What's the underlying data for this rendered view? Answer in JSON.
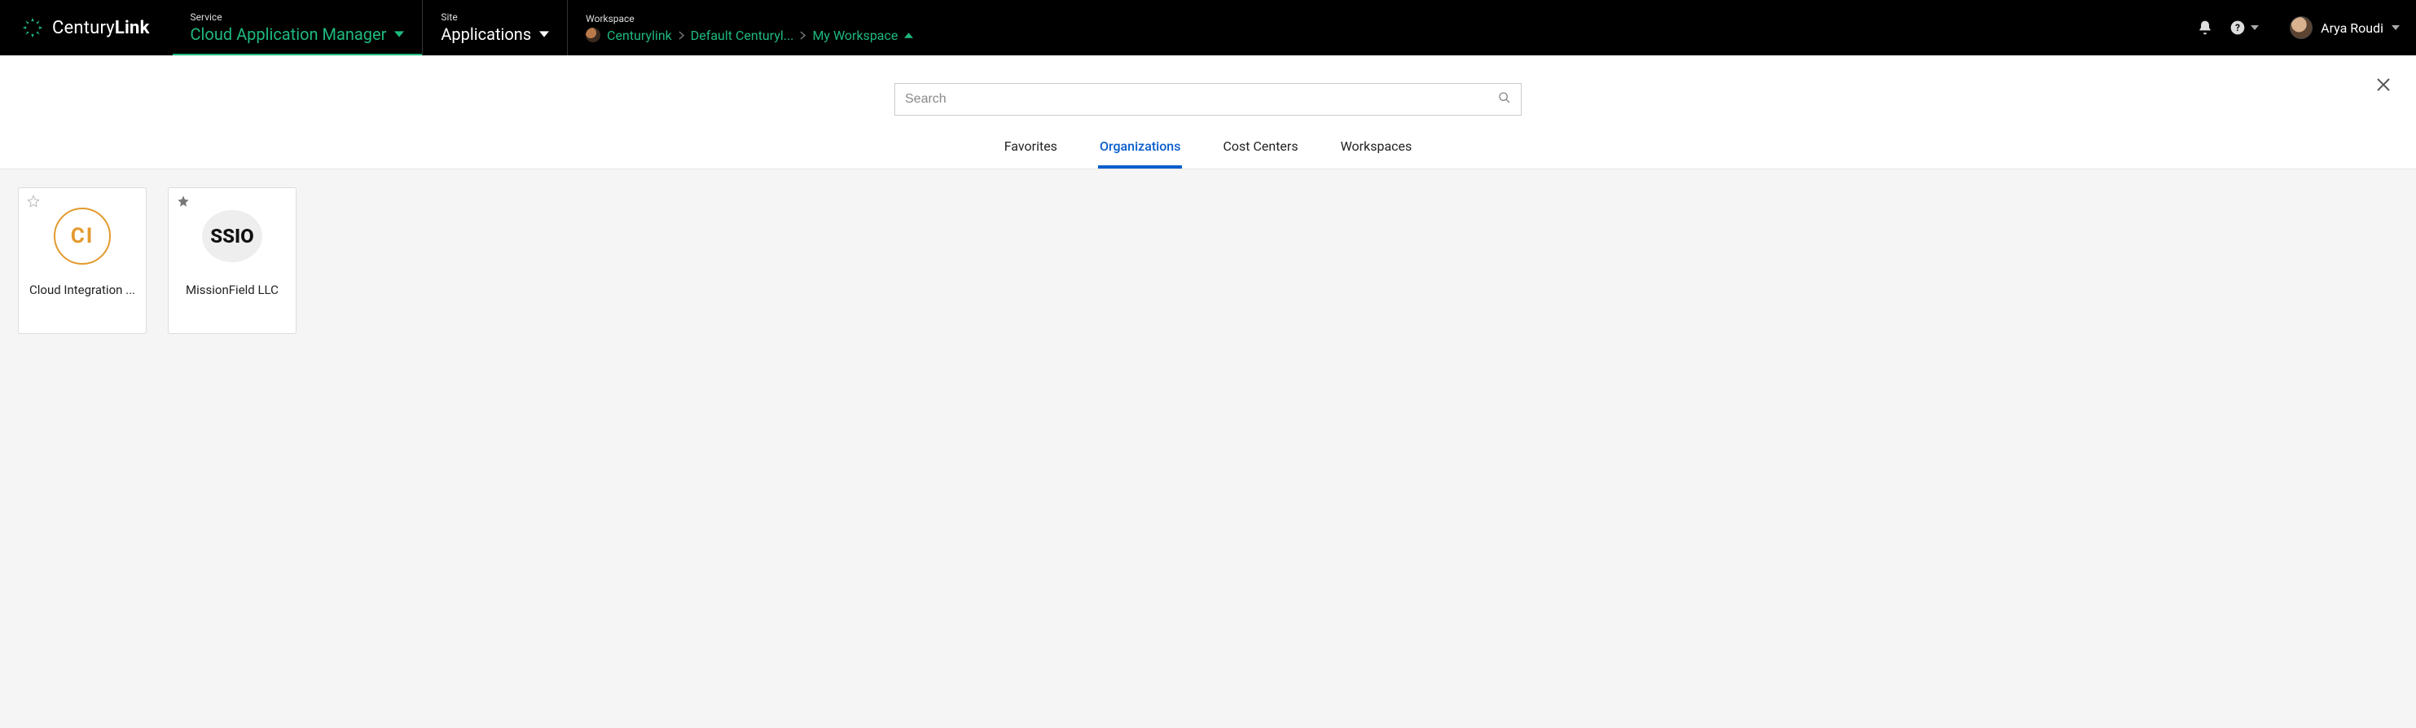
{
  "brand": {
    "name_a": "Century",
    "name_b": "Link"
  },
  "nav": {
    "service": {
      "label": "Service",
      "value": "Cloud Application Manager"
    },
    "site": {
      "label": "Site",
      "value": "Applications"
    },
    "workspace_label": "Workspace",
    "breadcrumb": {
      "org": "Centurylink",
      "cost_center": "Default Centuryl...",
      "workspace": "My Workspace"
    }
  },
  "user": {
    "name": "Arya Roudi"
  },
  "search": {
    "placeholder": "Search"
  },
  "tabs": [
    {
      "label": "Favorites",
      "active": false
    },
    {
      "label": "Organizations",
      "active": true
    },
    {
      "label": "Cost Centers",
      "active": false
    },
    {
      "label": "Workspaces",
      "active": false
    }
  ],
  "cards": [
    {
      "title": "Cloud Integration ...",
      "initials": "CI",
      "favorite": false,
      "kind": "initials"
    },
    {
      "title": "MissionField LLC",
      "logo_text": "SSIO",
      "favorite": true,
      "kind": "logo"
    }
  ]
}
